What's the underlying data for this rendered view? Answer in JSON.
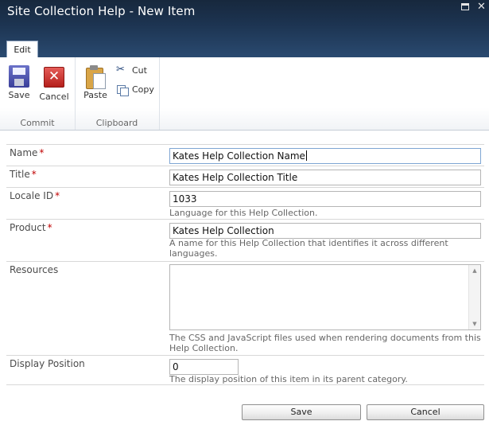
{
  "dialog": {
    "title": "Site Collection Help - New Item",
    "restore_icon": "restore-icon",
    "close_glyph": "✕"
  },
  "ribbon": {
    "active_tab": "Edit",
    "groups": {
      "commit": {
        "label": "Commit",
        "save": "Save",
        "cancel": "Cancel"
      },
      "clipboard": {
        "label": "Clipboard",
        "paste": "Paste",
        "cut": "Cut",
        "copy": "Copy"
      }
    }
  },
  "form": {
    "required_marker": "*",
    "fields": {
      "name": {
        "label": "Name",
        "value": "Kates Help Collection Name"
      },
      "title": {
        "label": "Title",
        "value": "Kates Help Collection Title"
      },
      "locale": {
        "label": "Locale ID",
        "value": "1033",
        "description": "Language for this Help Collection."
      },
      "product": {
        "label": "Product",
        "value": "Kates Help Collection",
        "description": "A name for this Help Collection that identifies it across different languages."
      },
      "resources": {
        "label": "Resources",
        "value": "",
        "description": "The CSS and JavaScript files used when rendering documents from this Help Collection."
      },
      "position": {
        "label": "Display Position",
        "value": "0",
        "description": "The display position of this item in its parent category."
      }
    }
  },
  "footer": {
    "save": "Save",
    "cancel": "Cancel"
  },
  "colors": {
    "titlebar": "#1c3350",
    "required": "#c00000",
    "accent_border": "#7fa6d3"
  }
}
